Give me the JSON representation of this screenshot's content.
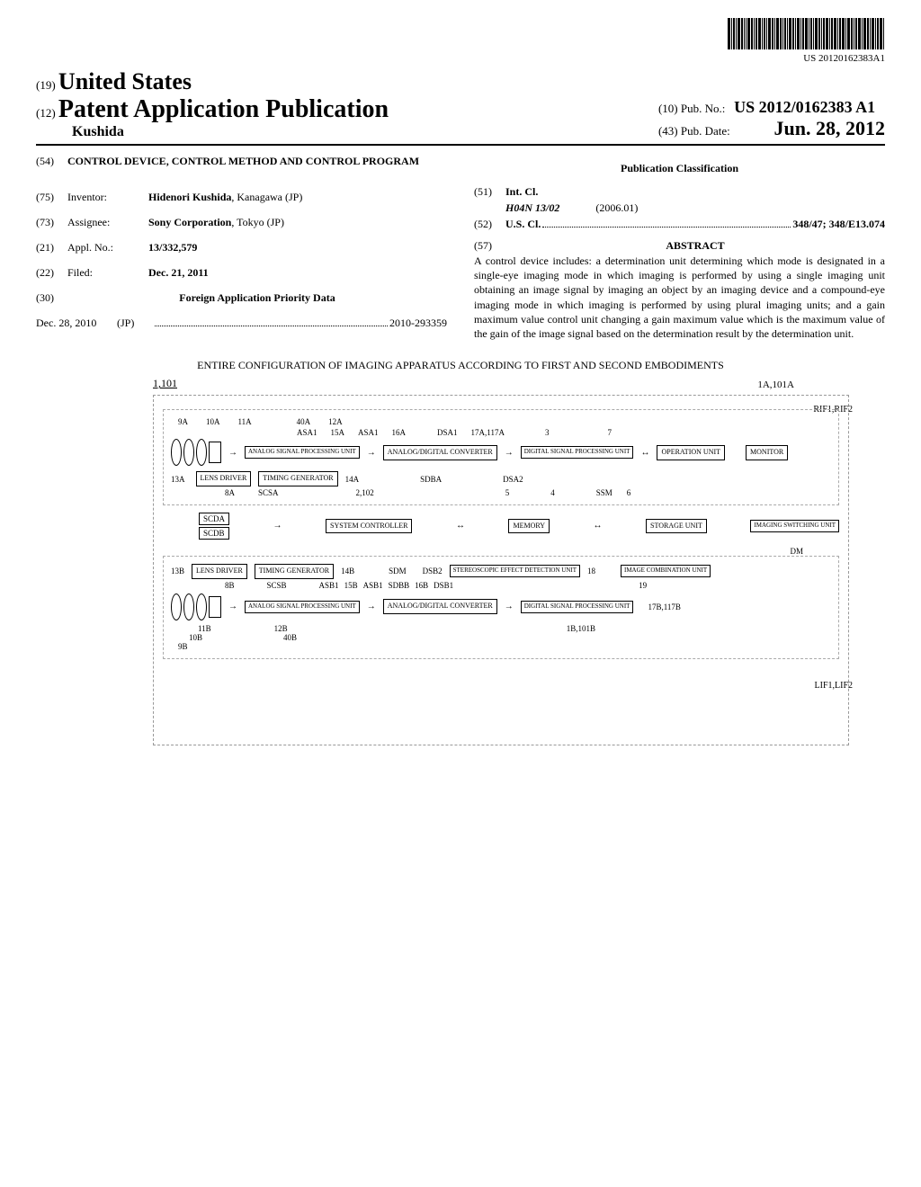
{
  "barcode_text": "US 20120162383A1",
  "header": {
    "code19": "(19)",
    "country": "United States",
    "code12": "(12)",
    "pub_type": "Patent Application Publication",
    "author": "Kushida",
    "code10": "(10)",
    "pub_no_label": "Pub. No.:",
    "pub_no": "US 2012/0162383 A1",
    "code43": "(43)",
    "pub_date_label": "Pub. Date:",
    "pub_date": "Jun. 28, 2012"
  },
  "left_col": {
    "f54": {
      "code": "(54)",
      "value": "CONTROL DEVICE, CONTROL METHOD AND CONTROL PROGRAM"
    },
    "f75": {
      "code": "(75)",
      "label": "Inventor:",
      "value_bold": "Hidenori Kushida",
      "value_rest": ", Kanagawa (JP)"
    },
    "f73": {
      "code": "(73)",
      "label": "Assignee:",
      "value_bold": "Sony Corporation",
      "value_rest": ", Tokyo (JP)"
    },
    "f21": {
      "code": "(21)",
      "label": "Appl. No.:",
      "value": "13/332,579"
    },
    "f22": {
      "code": "(22)",
      "label": "Filed:",
      "value": "Dec. 21, 2011"
    },
    "f30": {
      "code": "(30)",
      "heading": "Foreign Application Priority Data"
    },
    "priority": {
      "date": "Dec. 28, 2010",
      "country": "(JP)",
      "number": "2010-293359"
    }
  },
  "right_col": {
    "pub_class_heading": "Publication Classification",
    "f51": {
      "code": "(51)",
      "label": "Int. Cl.",
      "class": "H04N 13/02",
      "edition": "(2006.01)"
    },
    "f52": {
      "code": "(52)",
      "label": "U.S. Cl.",
      "value": "348/47; 348/E13.074"
    },
    "f57": {
      "code": "(57)",
      "heading": "ABSTRACT"
    },
    "abstract": "A control device includes: a determination unit determining which mode is designated in a single-eye imaging mode in which imaging is performed by using a single imaging unit obtaining an image signal by imaging an object by an imaging device and a compound-eye imaging mode in which imaging is performed by using plural imaging units; and a gain maximum value control unit changing a gain maximum value which is the maximum value of the gain of the image signal based on the determination result by the determination unit."
  },
  "figure": {
    "caption": "ENTIRE CONFIGURATION OF IMAGING APPARATUS ACCORDING TO FIRST AND SECOND EMBODIMENTS",
    "main_ref": "1,101",
    "ref_1a": "1A,101A",
    "ref_rif": "RIF1,RIF2",
    "ref_lif": "LIF1,LIF2",
    "ref_1b": "1B,101B",
    "blocks": {
      "analog_proc": "ANALOG SIGNAL PROCESSING UNIT",
      "ad_conv": "ANALOG/DIGITAL CONVERTER",
      "digital_proc": "DIGITAL SIGNAL PROCESSING UNIT",
      "operation": "OPERATION UNIT",
      "monitor": "MONITOR",
      "lens_driver": "LENS DRIVER",
      "timing_gen": "TIMING GENERATOR",
      "sys_ctrl": "SYSTEM CONTROLLER",
      "memory": "MEMORY",
      "storage": "STORAGE UNIT",
      "img_switch": "IMAGING SWITCHING UNIT",
      "stereo_detect": "STEREOSCOPIC EFFECT DETECTION UNIT",
      "img_combine": "IMAGE COMBINATION UNIT"
    },
    "refs_top": {
      "r9a": "9A",
      "r10a": "10A",
      "r11a": "11A",
      "r40a": "40A",
      "r12a": "12A",
      "asa1": "ASA1",
      "r15a": "15A",
      "asa1b": "ASA1",
      "r16a": "16A",
      "dsa1": "DSA1",
      "r17a": "17A,117A",
      "r3": "3",
      "r7": "7",
      "r14a": "14A",
      "r13a": "13A",
      "r8a": "8A",
      "scsa": "SCSA",
      "scda": "SCDA",
      "scdb": "SCDB",
      "sdba": "SDBA",
      "dsa2": "DSA2",
      "r2": "2,102",
      "r5": "5",
      "r4": "4",
      "ssm": "SSM",
      "r6": "6",
      "dm": "DM"
    },
    "refs_bot": {
      "r13b": "13B",
      "r8b": "8B",
      "scsb": "SCSB",
      "r14b": "14B",
      "sdm": "SDM",
      "dsb2": "DSB2",
      "r18": "18",
      "r19": "19",
      "asb1": "ASB1",
      "r15b": "15B",
      "asb1b": "ASB1",
      "sdbb": "SDBB",
      "r16b": "16B",
      "dsb1": "DSB1",
      "r17b": "17B,117B",
      "r11b": "11B",
      "r12b": "12B",
      "r40b": "40B",
      "r10b": "10B",
      "r9b": "9B"
    }
  }
}
